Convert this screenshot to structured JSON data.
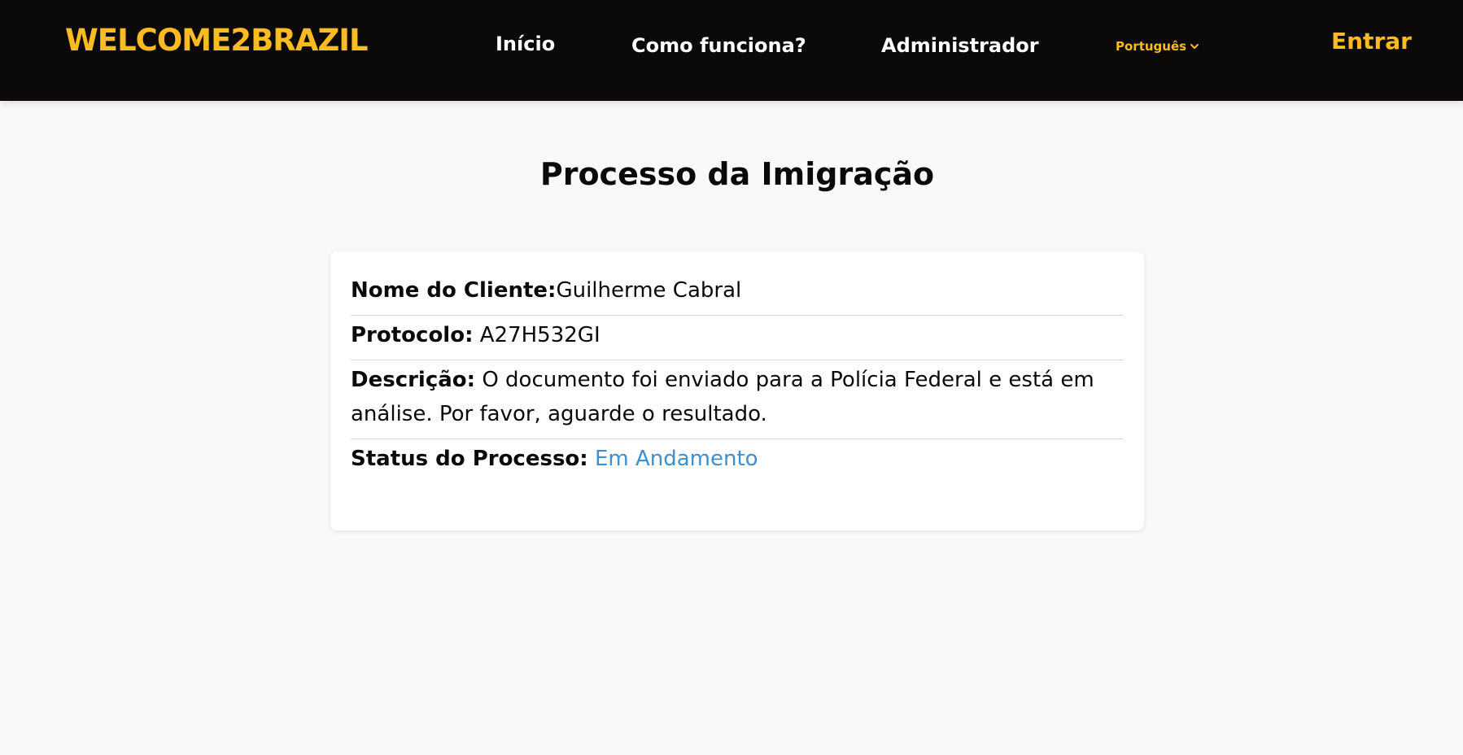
{
  "header": {
    "brand": "WELCOME2BRAZIL",
    "nav": {
      "inicio": "Início",
      "como_funciona": "Como funciona?",
      "administrador": "Administrador"
    },
    "language": "Português",
    "login": "Entrar"
  },
  "main": {
    "title": "Processo da Imigração",
    "details": {
      "client_label": "Nome do Cliente:",
      "client_value": "Guilherme Cabral",
      "protocol_label": "Protocolo:",
      "protocol_value": "A27H532GI",
      "description_label": "Descrição:",
      "description_value": "O documento foi enviado para a Polícia Federal e está em análise. Por favor, aguarde o resultado.",
      "status_label": "Status do Processo:",
      "status_value": "Em Andamento"
    }
  },
  "colors": {
    "navbar_bg": "#0b0a08",
    "accent_yellow": "#fbbb21",
    "status_blue": "#3d8fd1",
    "page_bg": "#f9f9f7"
  },
  "icons": {
    "language_dropdown": "chevron-down-icon"
  }
}
